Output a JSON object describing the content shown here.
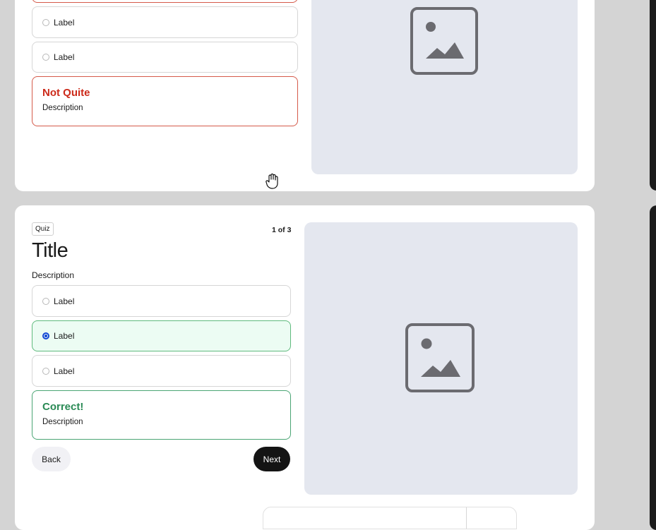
{
  "top_card": {
    "options": [
      {
        "label": "Label"
      },
      {
        "label": "Label"
      }
    ],
    "feedback": {
      "title": "Not Quite",
      "description": "Description"
    }
  },
  "bottom_card": {
    "tag": "Quiz",
    "counter": "1 of 3",
    "title": "Title",
    "description": "Description",
    "options": [
      {
        "label": "Label",
        "selected": false
      },
      {
        "label": "Label",
        "selected": true
      },
      {
        "label": "Label",
        "selected": false
      }
    ],
    "feedback": {
      "title": "Correct!",
      "description": "Description"
    },
    "back_label": "Back",
    "next_label": "Next"
  },
  "icons": {
    "image_placeholder": "image-placeholder-icon",
    "cursor": "hand-cursor-icon"
  },
  "colors": {
    "background": "#d4d4d4",
    "card": "#ffffff",
    "image_panel": "#e4e7ef",
    "error": "#cc2a1a",
    "success": "#2a8a55",
    "selected_bg": "#ecfcf3",
    "radio_selected": "#1346d6",
    "next_button": "#141414"
  }
}
